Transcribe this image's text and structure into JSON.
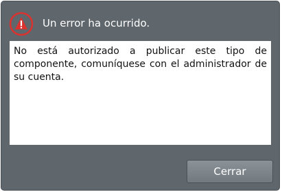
{
  "dialog": {
    "title": "Un error ha ocurrido.",
    "icon": "warning-icon",
    "message": "No está autorizado a publicar este tipo de componente, comuníquese con el administrador de su cuenta.",
    "close_label": "Cerrar"
  },
  "colors": {
    "dialog_bg": "#5f676d",
    "icon_red": "#d9322f",
    "button_bg": "#7d858b"
  }
}
